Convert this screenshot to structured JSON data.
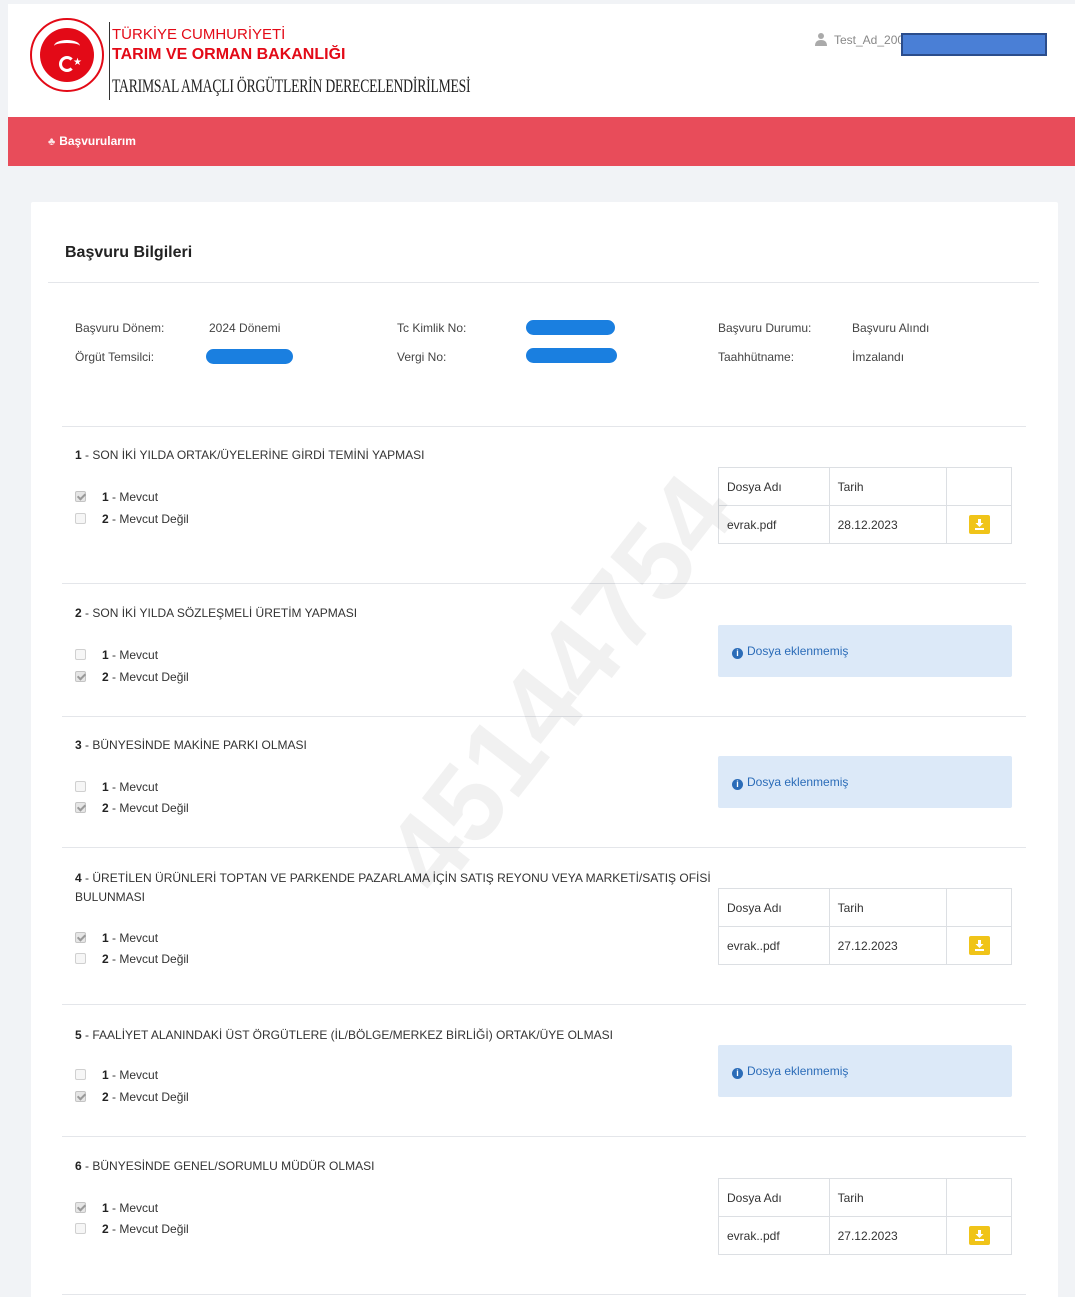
{
  "header": {
    "ministry_line1": "TÜRKİYE CUMHURİYETİ",
    "ministry_line2": "TARIM VE ORMAN BAKANLIĞI",
    "app_title": "TARIMSAL AMAÇLI ÖRGÜTLERİN DERECELENDİRİLMESİ",
    "user_name": "Test_Ad_2008"
  },
  "nav": {
    "item_basvurularim": "Başvurularım"
  },
  "card": {
    "title": "Başvuru Bilgileri",
    "info": {
      "donem_label": "Başvuru Dönem:",
      "donem_value": "2024 Dönemi",
      "temsilci_label": "Örgüt Temsilci:",
      "tc_label": "Tc Kimlik No:",
      "vergi_label": "Vergi No:",
      "durum_label": "Başvuru Durumu:",
      "durum_value": "Başvuru Alındı",
      "taahhut_label": "Taahhütname:",
      "taahhut_value": "İmzalandı"
    }
  },
  "file_table_headers": {
    "name": "Dosya Adı",
    "date": "Tarih"
  },
  "no_file_text": "Dosya eklenmemiş",
  "sections": [
    {
      "num": "1",
      "title": "SON İKİ YILDA ORTAK/ÜYELERİNE GİRDİ TEMİNİ YAPMASI",
      "opt1": "Mevcut",
      "opt2": "Mevcut Değil",
      "file": "evrak.pdf",
      "date": "28.12.2023"
    },
    {
      "num": "2",
      "title": "SON İKİ YILDA SÖZLEŞMELİ ÜRETİM YAPMASI",
      "opt1": "Mevcut",
      "opt2": "Mevcut Değil"
    },
    {
      "num": "3",
      "title": "BÜNYESİNDE MAKİNE PARKI OLMASI",
      "opt1": "Mevcut",
      "opt2": "Mevcut Değil"
    },
    {
      "num": "4",
      "title": "ÜRETİLEN ÜRÜNLERİ TOPTAN VE PARKENDE PAZARLAMA İÇİN SATIŞ REYONU VEYA MARKETİ/SATIŞ OFİSİ BULUNMASI",
      "opt1": "Mevcut",
      "opt2": "Mevcut Değil",
      "file": "evrak..pdf",
      "date": "27.12.2023"
    },
    {
      "num": "5",
      "title": "FAALİYET ALANINDAKİ ÜST ÖRGÜTLERE (İL/BÖLGE/MERKEZ BİRLİĞİ) ORTAK/ÜYE OLMASI",
      "opt1": "Mevcut",
      "opt2": "Mevcut Değil"
    },
    {
      "num": "6",
      "title": "BÜNYESİNDE GENEL/SORUMLU MÜDÜR OLMASI",
      "opt1": "Mevcut",
      "opt2": "Mevcut Değil",
      "file": "evrak..pdf",
      "date": "27.12.2023"
    }
  ],
  "colors": {
    "nav_red": "#e84c5a",
    "brand_red": "#e30a17",
    "download_yellow": "#f0c419",
    "info_blue": "#2b6cb8",
    "redaction_blue": "#1a7fe0"
  },
  "watermark_text": "45144754"
}
